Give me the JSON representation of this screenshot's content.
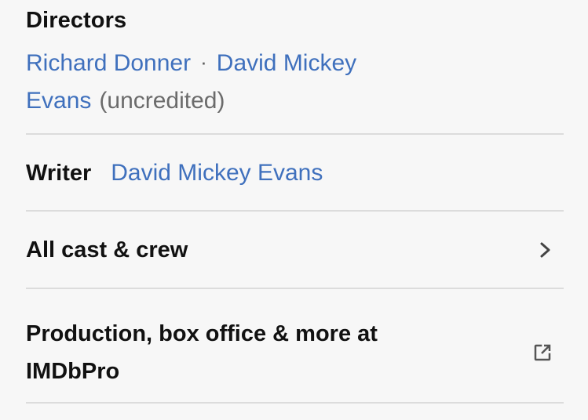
{
  "credits": {
    "directors": {
      "label": "Directors",
      "items": [
        {
          "name": "Richard Donner"
        },
        {
          "name": "David Mickey Evans",
          "note": "(uncredited)"
        }
      ],
      "separator": "·"
    },
    "writer": {
      "label": "Writer",
      "name": "David Mickey Evans"
    },
    "cast_crew": {
      "label": "All cast & crew",
      "icon": "chevron-right-icon"
    },
    "imdbpro": {
      "label": "Production, box office & more at IMDbPro",
      "icon": "external-link-icon"
    }
  },
  "colors": {
    "background": "#f7f7f7",
    "text": "#111111",
    "link": "#3f70bd",
    "muted": "#6b6b6b",
    "divider": "#dcdcdc"
  }
}
